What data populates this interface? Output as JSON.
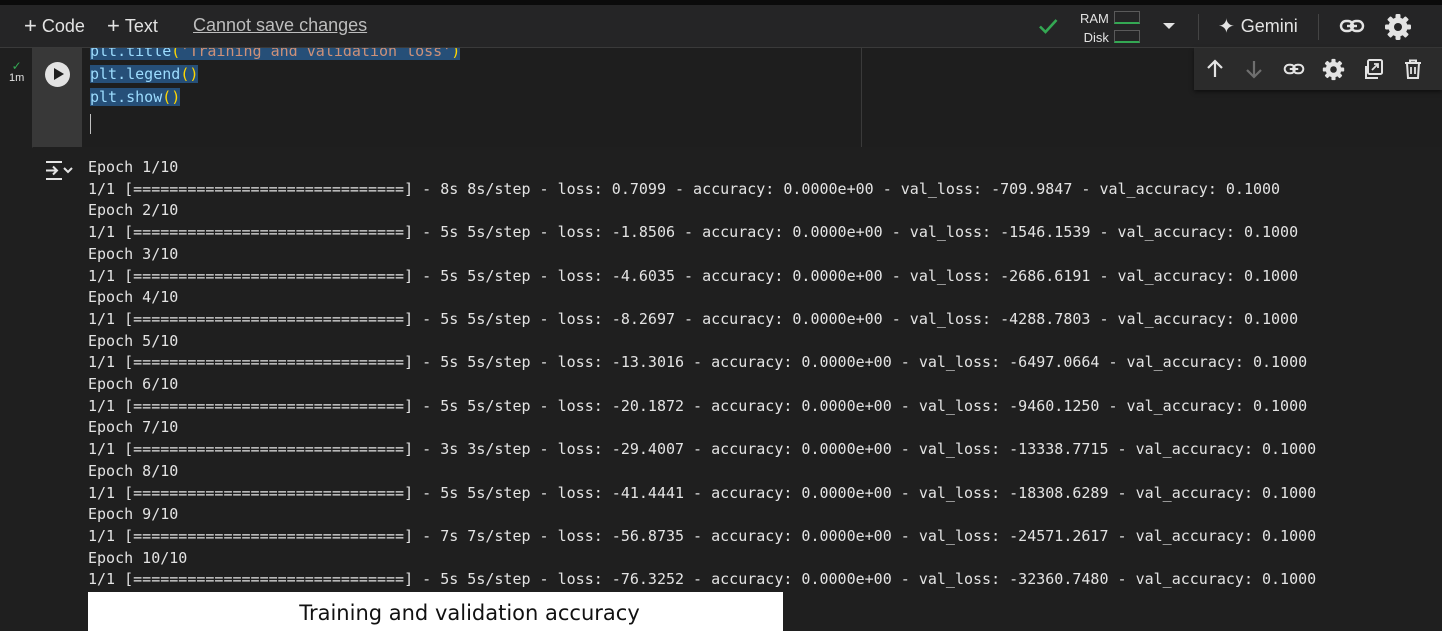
{
  "toolbar": {
    "add_code": "Code",
    "add_text": "Text",
    "save_status": "Cannot save changes",
    "ram_label": "RAM",
    "disk_label": "Disk",
    "gemini_label": "Gemini"
  },
  "cell": {
    "exec_time": "1m",
    "code_lines": [
      {
        "pre": "plt.title",
        "arg": "'Training and validation loss'"
      },
      {
        "pre": "plt.legend",
        "arg": ""
      },
      {
        "pre": "plt.show",
        "arg": ""
      }
    ]
  },
  "output": {
    "log_lines": [
      "Epoch 1/10",
      "1/1 [==============================] - 8s 8s/step - loss: 0.7099 - accuracy: 0.0000e+00 - val_loss: -709.9847 - val_accuracy: 0.1000",
      "Epoch 2/10",
      "1/1 [==============================] - 5s 5s/step - loss: -1.8506 - accuracy: 0.0000e+00 - val_loss: -1546.1539 - val_accuracy: 0.1000",
      "Epoch 3/10",
      "1/1 [==============================] - 5s 5s/step - loss: -4.6035 - accuracy: 0.0000e+00 - val_loss: -2686.6191 - val_accuracy: 0.1000",
      "Epoch 4/10",
      "1/1 [==============================] - 5s 5s/step - loss: -8.2697 - accuracy: 0.0000e+00 - val_loss: -4288.7803 - val_accuracy: 0.1000",
      "Epoch 5/10",
      "1/1 [==============================] - 5s 5s/step - loss: -13.3016 - accuracy: 0.0000e+00 - val_loss: -6497.0664 - val_accuracy: 0.1000",
      "Epoch 6/10",
      "1/1 [==============================] - 5s 5s/step - loss: -20.1872 - accuracy: 0.0000e+00 - val_loss: -9460.1250 - val_accuracy: 0.1000",
      "Epoch 7/10",
      "1/1 [==============================] - 3s 3s/step - loss: -29.4007 - accuracy: 0.0000e+00 - val_loss: -13338.7715 - val_accuracy: 0.1000",
      "Epoch 8/10",
      "1/1 [==============================] - 5s 5s/step - loss: -41.4441 - accuracy: 0.0000e+00 - val_loss: -18308.6289 - val_accuracy: 0.1000",
      "Epoch 9/10",
      "1/1 [==============================] - 7s 7s/step - loss: -56.8735 - accuracy: 0.0000e+00 - val_loss: -24571.2617 - val_accuracy: 0.1000",
      "Epoch 10/10",
      "1/1 [==============================] - 5s 5s/step - loss: -76.3252 - accuracy: 0.0000e+00 - val_loss: -32360.7480 - val_accuracy: 0.1000"
    ],
    "plot_title": "Training and validation accuracy"
  },
  "icons": {
    "status": "check-icon",
    "run": "play-icon",
    "output_toggle": "output-icon",
    "cell_tools": [
      "arrow-up-icon",
      "arrow-down-icon",
      "link-icon",
      "gear-icon",
      "mirror-icon",
      "trash-icon"
    ],
    "toolbar": [
      "link-icon",
      "gear-icon",
      "chevron-down-icon",
      "sparkle-icon"
    ]
  },
  "colors": {
    "accent_green": "#34a853",
    "selection": "#264f78",
    "background": "#1f1f1f"
  }
}
